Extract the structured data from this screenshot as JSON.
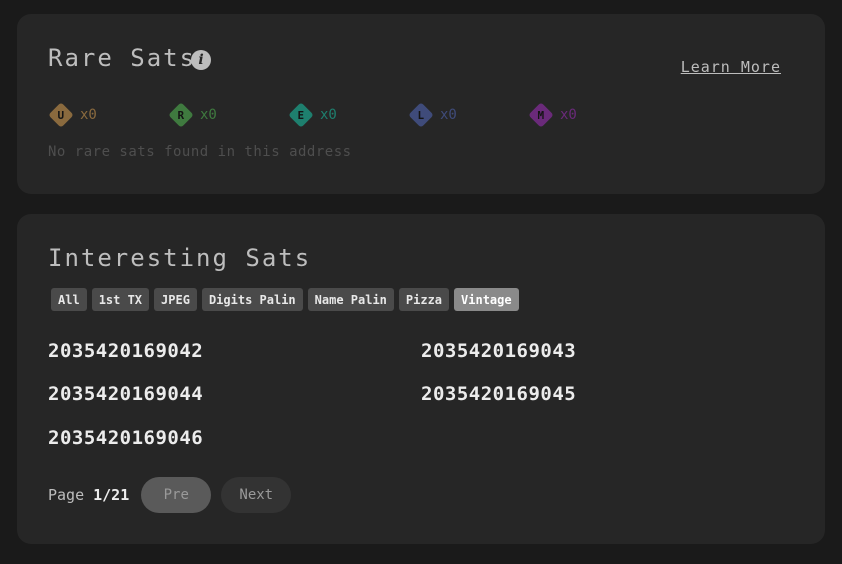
{
  "rare_sats": {
    "title": "Rare Sats",
    "info_glyph": "i",
    "learn_more": "Learn More",
    "rarities": [
      {
        "letter": "U",
        "count": "x0",
        "color": "#8a6a3e"
      },
      {
        "letter": "R",
        "count": "x0",
        "color": "#3f7a3f"
      },
      {
        "letter": "E",
        "count": "x0",
        "color": "#1e7f6e"
      },
      {
        "letter": "L",
        "count": "x0",
        "color": "#3f4b7a"
      },
      {
        "letter": "M",
        "count": "x0",
        "color": "#6a2a7a"
      }
    ],
    "empty_message": "No rare sats found in this address"
  },
  "interesting_sats": {
    "title": "Interesting Sats",
    "filters": [
      "All",
      "1st TX",
      "JPEG",
      "Digits Palin",
      "Name Palin",
      "Pizza",
      "Vintage"
    ],
    "active_filter": "Vintage",
    "sats": [
      "2035420169042",
      "2035420169043",
      "2035420169044",
      "2035420169045",
      "2035420169046"
    ],
    "pagination": {
      "label": "Page",
      "current": "1/21",
      "prev_label": "Pre",
      "next_label": "Next"
    }
  }
}
